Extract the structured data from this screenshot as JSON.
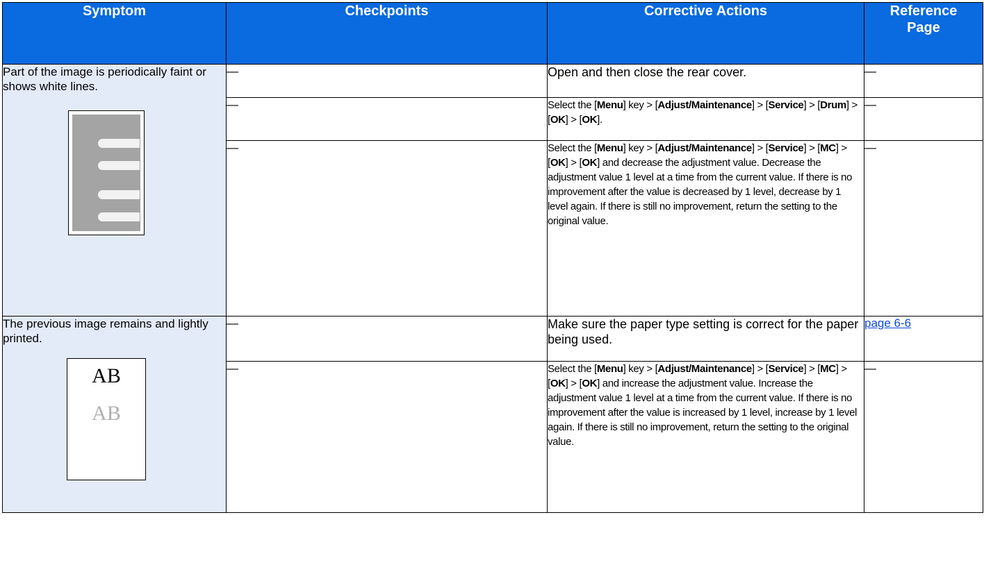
{
  "headers": {
    "symptom": "Symptom",
    "checkpoints": "Checkpoints",
    "corrective": "Corrective Actions",
    "reference_line1": "Reference",
    "reference_line2": "Page"
  },
  "groups": [
    {
      "symptom": "Part of the image is periodically faint or shows white lines.",
      "illustration": "faint-lines-illustration",
      "rows": [
        {
          "checkpoint": "—",
          "action_text": "Open and then close the rear cover.",
          "reference": "—"
        },
        {
          "checkpoint": "—",
          "action_parts": {
            "a": "Select the [",
            "b": "Menu",
            "c": "] key > [",
            "d": "Adjust/Maintenance",
            "e": "] > [",
            "f": "Service",
            "g": "] > [",
            "h": "Drum",
            "i": "] > [",
            "j": "OK",
            "k": "] > [",
            "l": "OK",
            "m": "]."
          },
          "reference": "—"
        },
        {
          "checkpoint": "—",
          "action_parts": {
            "a": "Select the [",
            "b": "Menu",
            "c": "] key > [",
            "d": "Adjust/Maintenance",
            "e": "] > [",
            "f": "Service",
            "g": "] > [",
            "h": "MC",
            "i": "] > [",
            "j": "OK",
            "k": "] > [",
            "l": "OK",
            "m": "] and decrease the adjustment value. Decrease the adjustment value 1 level at a time from the current value. If there is no improvement after the value is decreased by 1 level, decrease by 1 level again. If there is still no improvement, return the setting to the original value."
          },
          "reference": "—"
        }
      ]
    },
    {
      "symptom": "The previous image remains and lightly printed.",
      "illustration": "ghost-image-illustration",
      "illustration_text_1": "AB",
      "illustration_text_2": "AB",
      "rows": [
        {
          "checkpoint": "—",
          "action_text": "Make sure the paper type setting is correct for the paper being used.",
          "reference_link": "page 6-6"
        },
        {
          "checkpoint": "—",
          "action_parts": {
            "a": "Select the [",
            "b": "Menu",
            "c": "] key > [",
            "d": "Adjust/Maintenance",
            "e": "] > [",
            "f": "Service",
            "g": "] > [",
            "h": "MC",
            "i": "] > [",
            "j": "OK",
            "k": "] > [",
            "l": "OK",
            "m": "] and increase the adjustment value. Increase the adjustment value 1 level at a time from the current value. If there is no improvement after the value is increased by 1 level, increase by 1 level again. If there is still no improvement, return the setting to the original value."
          },
          "reference": "—"
        }
      ]
    }
  ],
  "colors": {
    "header_bg": "#0a6ae0",
    "symptom_bg": "#e3eaf8",
    "link": "#0a4ad8"
  }
}
